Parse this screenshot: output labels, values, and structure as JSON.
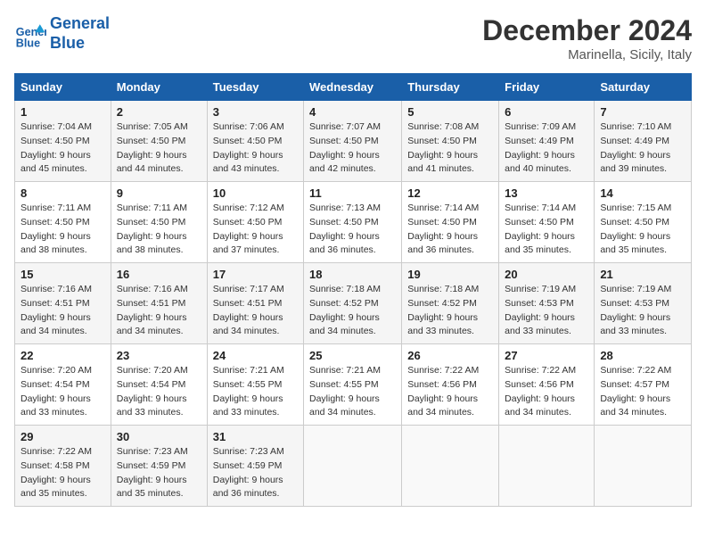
{
  "header": {
    "logo_line1": "General",
    "logo_line2": "Blue",
    "month": "December 2024",
    "location": "Marinella, Sicily, Italy"
  },
  "weekdays": [
    "Sunday",
    "Monday",
    "Tuesday",
    "Wednesday",
    "Thursday",
    "Friday",
    "Saturday"
  ],
  "weeks": [
    [
      {
        "day": "1",
        "sunrise": "7:04 AM",
        "sunset": "4:50 PM",
        "daylight": "9 hours and 45 minutes."
      },
      {
        "day": "2",
        "sunrise": "7:05 AM",
        "sunset": "4:50 PM",
        "daylight": "9 hours and 44 minutes."
      },
      {
        "day": "3",
        "sunrise": "7:06 AM",
        "sunset": "4:50 PM",
        "daylight": "9 hours and 43 minutes."
      },
      {
        "day": "4",
        "sunrise": "7:07 AM",
        "sunset": "4:50 PM",
        "daylight": "9 hours and 42 minutes."
      },
      {
        "day": "5",
        "sunrise": "7:08 AM",
        "sunset": "4:50 PM",
        "daylight": "9 hours and 41 minutes."
      },
      {
        "day": "6",
        "sunrise": "7:09 AM",
        "sunset": "4:49 PM",
        "daylight": "9 hours and 40 minutes."
      },
      {
        "day": "7",
        "sunrise": "7:10 AM",
        "sunset": "4:49 PM",
        "daylight": "9 hours and 39 minutes."
      }
    ],
    [
      {
        "day": "8",
        "sunrise": "7:11 AM",
        "sunset": "4:50 PM",
        "daylight": "9 hours and 38 minutes."
      },
      {
        "day": "9",
        "sunrise": "7:11 AM",
        "sunset": "4:50 PM",
        "daylight": "9 hours and 38 minutes."
      },
      {
        "day": "10",
        "sunrise": "7:12 AM",
        "sunset": "4:50 PM",
        "daylight": "9 hours and 37 minutes."
      },
      {
        "day": "11",
        "sunrise": "7:13 AM",
        "sunset": "4:50 PM",
        "daylight": "9 hours and 36 minutes."
      },
      {
        "day": "12",
        "sunrise": "7:14 AM",
        "sunset": "4:50 PM",
        "daylight": "9 hours and 36 minutes."
      },
      {
        "day": "13",
        "sunrise": "7:14 AM",
        "sunset": "4:50 PM",
        "daylight": "9 hours and 35 minutes."
      },
      {
        "day": "14",
        "sunrise": "7:15 AM",
        "sunset": "4:50 PM",
        "daylight": "9 hours and 35 minutes."
      }
    ],
    [
      {
        "day": "15",
        "sunrise": "7:16 AM",
        "sunset": "4:51 PM",
        "daylight": "9 hours and 34 minutes."
      },
      {
        "day": "16",
        "sunrise": "7:16 AM",
        "sunset": "4:51 PM",
        "daylight": "9 hours and 34 minutes."
      },
      {
        "day": "17",
        "sunrise": "7:17 AM",
        "sunset": "4:51 PM",
        "daylight": "9 hours and 34 minutes."
      },
      {
        "day": "18",
        "sunrise": "7:18 AM",
        "sunset": "4:52 PM",
        "daylight": "9 hours and 34 minutes."
      },
      {
        "day": "19",
        "sunrise": "7:18 AM",
        "sunset": "4:52 PM",
        "daylight": "9 hours and 33 minutes."
      },
      {
        "day": "20",
        "sunrise": "7:19 AM",
        "sunset": "4:53 PM",
        "daylight": "9 hours and 33 minutes."
      },
      {
        "day": "21",
        "sunrise": "7:19 AM",
        "sunset": "4:53 PM",
        "daylight": "9 hours and 33 minutes."
      }
    ],
    [
      {
        "day": "22",
        "sunrise": "7:20 AM",
        "sunset": "4:54 PM",
        "daylight": "9 hours and 33 minutes."
      },
      {
        "day": "23",
        "sunrise": "7:20 AM",
        "sunset": "4:54 PM",
        "daylight": "9 hours and 33 minutes."
      },
      {
        "day": "24",
        "sunrise": "7:21 AM",
        "sunset": "4:55 PM",
        "daylight": "9 hours and 33 minutes."
      },
      {
        "day": "25",
        "sunrise": "7:21 AM",
        "sunset": "4:55 PM",
        "daylight": "9 hours and 34 minutes."
      },
      {
        "day": "26",
        "sunrise": "7:22 AM",
        "sunset": "4:56 PM",
        "daylight": "9 hours and 34 minutes."
      },
      {
        "day": "27",
        "sunrise": "7:22 AM",
        "sunset": "4:56 PM",
        "daylight": "9 hours and 34 minutes."
      },
      {
        "day": "28",
        "sunrise": "7:22 AM",
        "sunset": "4:57 PM",
        "daylight": "9 hours and 34 minutes."
      }
    ],
    [
      {
        "day": "29",
        "sunrise": "7:22 AM",
        "sunset": "4:58 PM",
        "daylight": "9 hours and 35 minutes."
      },
      {
        "day": "30",
        "sunrise": "7:23 AM",
        "sunset": "4:59 PM",
        "daylight": "9 hours and 35 minutes."
      },
      {
        "day": "31",
        "sunrise": "7:23 AM",
        "sunset": "4:59 PM",
        "daylight": "9 hours and 36 minutes."
      },
      null,
      null,
      null,
      null
    ]
  ]
}
